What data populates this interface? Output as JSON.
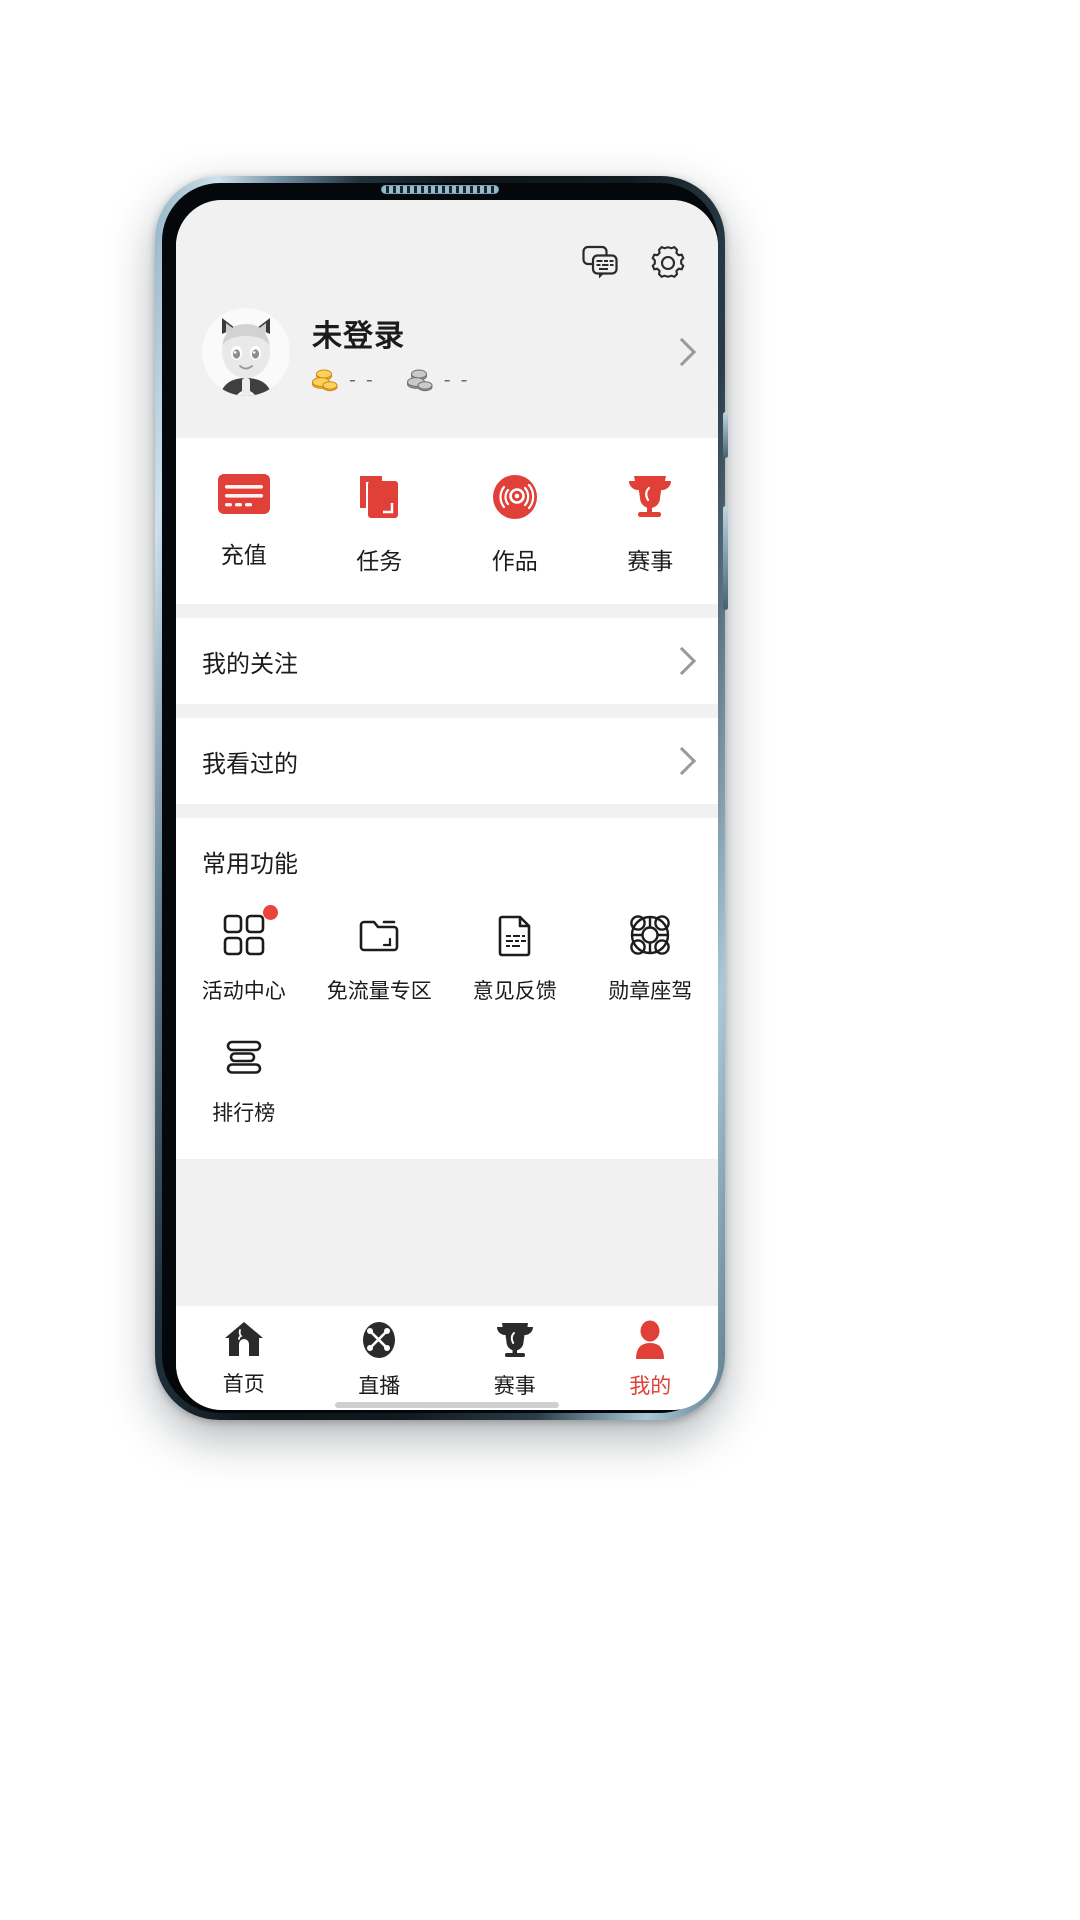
{
  "theme": {
    "accent": "#e04038",
    "screen_bg": "#f1f1f1",
    "card_bg": "#ffffff",
    "text": "#1c1c1c",
    "muted": "#6b6b6b"
  },
  "topbar": {
    "message_icon": "message-bubbles-icon",
    "settings_icon": "gear-icon"
  },
  "profile": {
    "avatar_icon": "cat-girl-avatar",
    "name": "未登录",
    "gold": {
      "icon": "gold-coins-icon",
      "value": "- -"
    },
    "silver": {
      "icon": "silver-coins-icon",
      "value": "- -"
    },
    "chevron_icon": "chevron-right-icon"
  },
  "quick_actions": [
    {
      "label": "充值",
      "icon": "recharge-card-icon"
    },
    {
      "label": "任务",
      "icon": "task-pages-icon"
    },
    {
      "label": "作品",
      "icon": "vinyl-record-icon"
    },
    {
      "label": "赛事",
      "icon": "trophy-icon"
    }
  ],
  "rows": [
    {
      "label": "我的关注",
      "chevron_icon": "chevron-right-icon"
    },
    {
      "label": "我看过的",
      "chevron_icon": "chevron-right-icon"
    }
  ],
  "common": {
    "title": "常用功能",
    "items": [
      {
        "label": "活动中心",
        "icon": "grid-squares-icon",
        "badge": true
      },
      {
        "label": "免流量专区",
        "icon": "folder-icon",
        "badge": false
      },
      {
        "label": "意见反馈",
        "icon": "document-feedback-icon",
        "badge": false
      },
      {
        "label": "勋章座驾",
        "icon": "medal-lifering-icon",
        "badge": false
      },
      {
        "label": "排行榜",
        "icon": "ranking-bars-icon",
        "badge": false
      }
    ]
  },
  "tabbar": {
    "items": [
      {
        "label": "首页",
        "icon": "home-icon",
        "active": false
      },
      {
        "label": "直播",
        "icon": "live-broadcast-icon",
        "active": false
      },
      {
        "label": "赛事",
        "icon": "trophy-icon",
        "active": false
      },
      {
        "label": "我的",
        "icon": "person-icon",
        "active": true
      }
    ]
  }
}
